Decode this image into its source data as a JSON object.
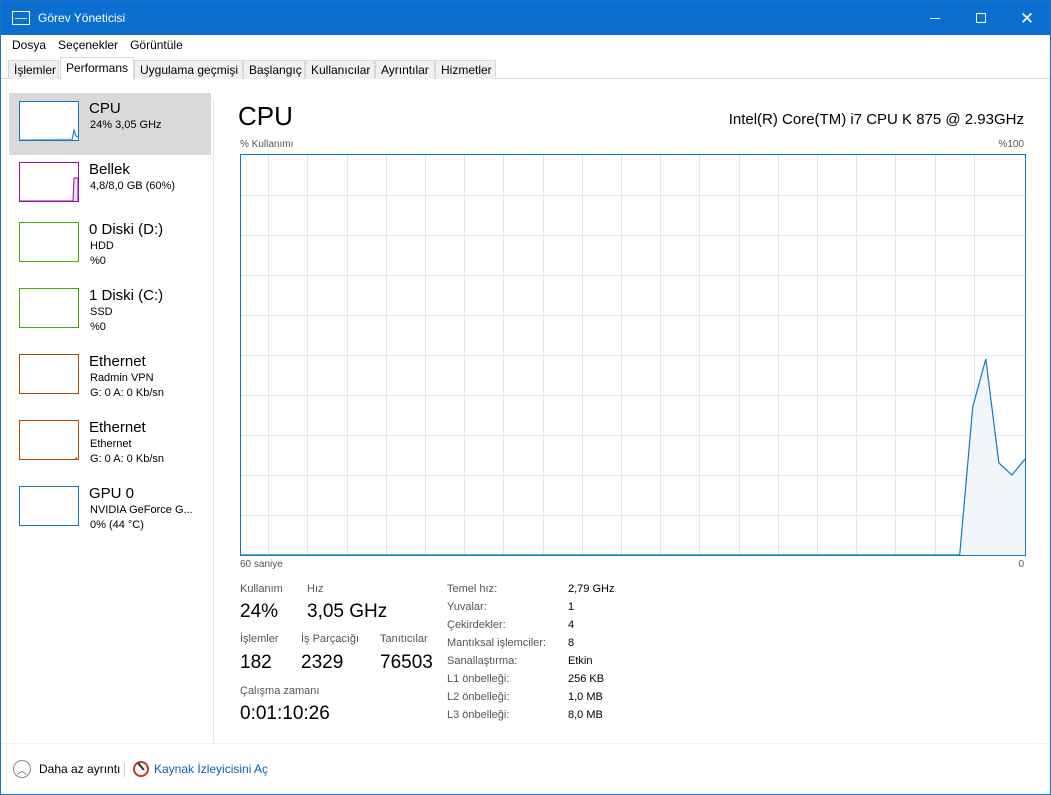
{
  "window": {
    "title": "Görev Yöneticisi"
  },
  "menu": [
    "Dosya",
    "Seçenekler",
    "Görüntüle"
  ],
  "tabs": [
    "İşlemler",
    "Performans",
    "Uygulama geçmişi",
    "Başlangıç",
    "Kullanıcılar",
    "Ayrıntılar",
    "Hizmetler"
  ],
  "active_tab": "Performans",
  "sidebar": [
    {
      "title": "CPU",
      "line1": "24% 3,05 GHz",
      "line2": "",
      "color": "#1179bd"
    },
    {
      "title": "Bellek",
      "line1": "4,8/8,0 GB (60%)",
      "line2": "",
      "color": "#8b12ae"
    },
    {
      "title": "0 Diski (D:)",
      "line1": "HDD",
      "line2": "%0",
      "color": "#4da60c"
    },
    {
      "title": "1 Diski (C:)",
      "line1": "SSD",
      "line2": "%0",
      "color": "#4da60c"
    },
    {
      "title": "Ethernet",
      "line1": "Radmin VPN",
      "line2": "G: 0 A: 0 Kb/sn",
      "color": "#a74f01"
    },
    {
      "title": "Ethernet",
      "line1": "Ethernet",
      "line2": "G: 0 A: 0 Kb/sn",
      "color": "#a74f01"
    },
    {
      "title": "GPU 0",
      "line1": "NVIDIA GeForce G...",
      "line2": "0% (44 °C)",
      "color": "#1179bd"
    }
  ],
  "main": {
    "title": "CPU",
    "model": "Intel(R) Core(TM) i7 CPU K 875 @ 2.93GHz",
    "graph_top_left": "% Kullanımı",
    "graph_top_right": "%100",
    "graph_bottom_left": "60 saniye",
    "graph_bottom_right": "0"
  },
  "stats": {
    "usage_label": "Kullanım",
    "usage_value": "24%",
    "speed_label": "Hız",
    "speed_value": "3,05 GHz",
    "processes_label": "İşlemler",
    "processes_value": "182",
    "threads_label": "İş Parçacığı",
    "threads_value": "2329",
    "handles_label": "Tanıtıcılar",
    "handles_value": "76503",
    "uptime_label": "Çalışma zamanı",
    "uptime_value": "0:01:10:26"
  },
  "info": [
    {
      "label": "Temel hız:",
      "value": "2,79 GHz"
    },
    {
      "label": "Yuvalar:",
      "value": "1"
    },
    {
      "label": "Çekirdekler:",
      "value": "4"
    },
    {
      "label": "Mantıksal işlemciler:",
      "value": "8"
    },
    {
      "label": "Sanallaştırma:",
      "value": "Etkin"
    },
    {
      "label": "L1 önbelleği:",
      "value": "256 KB"
    },
    {
      "label": "L2 önbelleği:",
      "value": "1,0 MB"
    },
    {
      "label": "L3 önbelleği:",
      "value": "8,0 MB"
    }
  ],
  "footer": {
    "less_details": "Daha az ayrıntı",
    "resource_monitor": "Kaynak İzleyicisini Aç"
  },
  "chart_data": {
    "type": "area",
    "x_range_seconds": [
      60,
      0
    ],
    "ylim": [
      0,
      100
    ],
    "grid": true,
    "x": [
      60,
      58,
      56,
      54,
      52,
      50,
      48,
      46,
      44,
      42,
      40,
      38,
      36,
      34,
      32,
      30,
      28,
      26,
      24,
      22,
      20,
      18,
      16,
      14,
      12,
      10,
      8,
      6,
      5,
      4,
      3,
      2,
      1,
      0
    ],
    "values": [
      0,
      0,
      0,
      0,
      0,
      0,
      0,
      0,
      0,
      0,
      0,
      0,
      0,
      0,
      0,
      0,
      0,
      0,
      0,
      0,
      0,
      0,
      0,
      0,
      0,
      0,
      0,
      0,
      0,
      37,
      49,
      23,
      20,
      24
    ],
    "color": "#1179bd"
  }
}
